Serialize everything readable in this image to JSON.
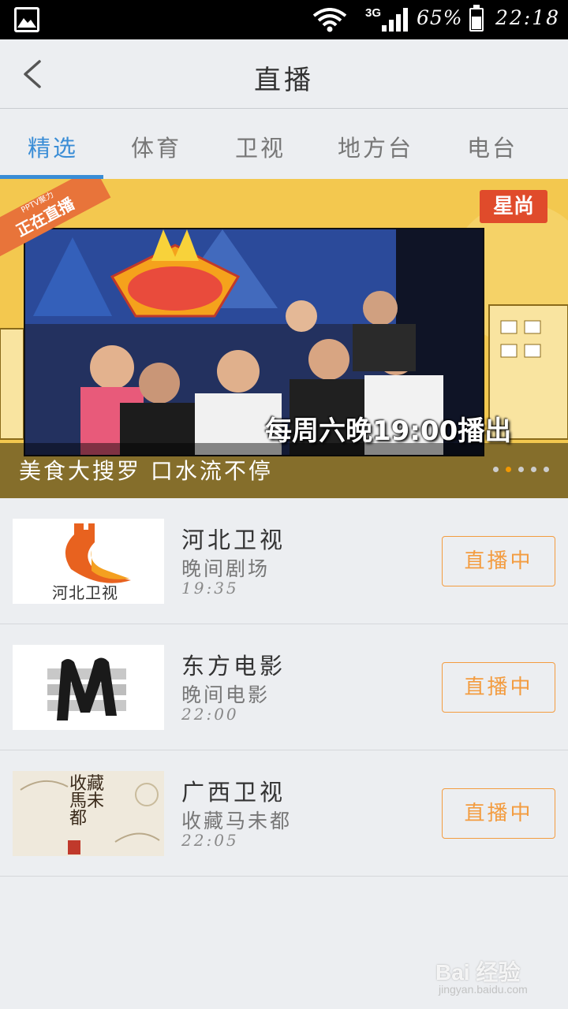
{
  "status_bar": {
    "network": "3G",
    "battery_percent": "65%",
    "time": "22:18",
    "icons": [
      "gallery-icon",
      "wifi-icon",
      "signal-icon",
      "battery-icon"
    ]
  },
  "header": {
    "title": "直播",
    "back_icon": "chevron-left-icon"
  },
  "tabs": [
    {
      "label": "精选",
      "active": true
    },
    {
      "label": "体育",
      "active": false
    },
    {
      "label": "卫视",
      "active": false
    },
    {
      "label": "地方台",
      "active": false
    },
    {
      "label": "电台",
      "active": false
    }
  ],
  "banner": {
    "ribbon_sub": "PPTV聚力",
    "ribbon_main": "正在直播",
    "brand_badge": "星尚",
    "schedule": "每周六晚19:00播出",
    "caption": "美食大搜罗 口水流不停",
    "page_count": 5,
    "current_page": 2
  },
  "channels": [
    {
      "name": "河北卫视",
      "show": "晚间剧场",
      "time": "19:35",
      "button": "直播中",
      "logo_text": "河北卫视"
    },
    {
      "name": "东方电影",
      "show": "晚间电影",
      "time": "22:00",
      "button": "直播中"
    },
    {
      "name": "广西卫视",
      "show": "收藏马未都",
      "time": "22:05",
      "button": "直播中",
      "logo_text": "收藏馬未都"
    }
  ],
  "watermark": {
    "main": "Bai 经验",
    "sub": "jingyan.baidu.com"
  },
  "colors": {
    "accent": "#3a8dd6",
    "live_button": "#f39c40",
    "dot_active": "#f39800"
  }
}
